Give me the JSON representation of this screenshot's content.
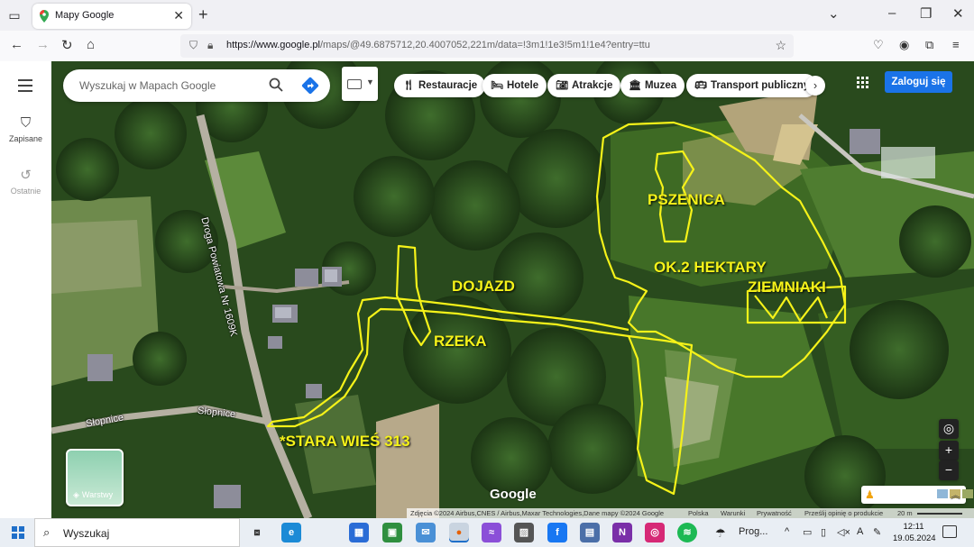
{
  "browser": {
    "tab_title": "Mapy Google",
    "url_host": "https://www.google.pl",
    "url_path": "/maps/@49.6875712,20.4007052,221m/data=!3m1!1e3!5m1!1e4?entry=ttu"
  },
  "rail": {
    "saved_label": "Zapisane",
    "recent_label": "Ostatnie"
  },
  "search": {
    "placeholder": "Wyszukaj w Mapach Google"
  },
  "chips": [
    {
      "label": "Restauracje",
      "icon": "fork-knife-icon"
    },
    {
      "label": "Hotele",
      "icon": "bed-icon"
    },
    {
      "label": "Atrakcje",
      "icon": "camera-icon"
    },
    {
      "label": "Muzea",
      "icon": "museum-icon"
    },
    {
      "label": "Transport publiczny",
      "icon": "bus-icon"
    }
  ],
  "login_label": "Zaloguj się",
  "layers_label": "Warstwy",
  "map_labels": {
    "road_vertical": "Droga Powiatowa Nr 1609K",
    "road_left": "Słopnice",
    "road_right": "Słopnice"
  },
  "annotations": {
    "pszenica": "PSZENICA",
    "area": "OK.2 HEKTARY",
    "ziemniaki": "ZIEMNIAKI",
    "dojazd": "DOJAZD",
    "rzeka": "RZEKA",
    "address": "*STARA WIEŚ 313"
  },
  "google_logo": "Google",
  "attribution": {
    "imagery": "Zdjęcia ©2024 Airbus,CNES / Airbus,Maxar Technologies,Dane mapy ©2024 Google",
    "country": "Polska",
    "terms": "Warunki",
    "privacy": "Prywatność",
    "feedback": "Prześlij opinię o produkcie",
    "scale": "20 m"
  },
  "taskbar": {
    "search_label": "Wyszukaj",
    "running_app_label": "Prog...",
    "time": "12:11",
    "date": "19.05.2024"
  },
  "colors": {
    "annotation_yellow": "#f5f219",
    "google_blue": "#1a73e8"
  }
}
